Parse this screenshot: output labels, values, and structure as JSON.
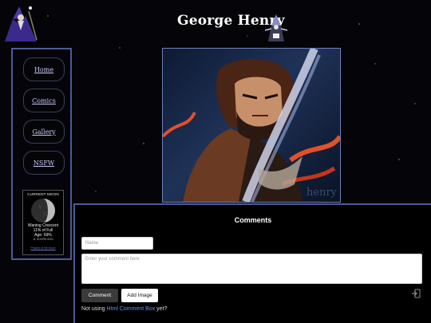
{
  "header": {
    "title": "George Henry"
  },
  "nav": {
    "items": [
      {
        "label": "Home"
      },
      {
        "label": "Comics"
      },
      {
        "label": "Gallery"
      },
      {
        "label": "NSFW"
      }
    ]
  },
  "moon": {
    "title": "CURRENT MOON",
    "phase": "Waning Crescent",
    "illumination": "11% of Full",
    "age": "Age: 69%",
    "extra": "11 HOURS AGO",
    "link": "Phases of the Moon"
  },
  "artwork": {
    "watermark": "henry"
  },
  "comments": {
    "heading": "Comments",
    "name_placeholder": "Name",
    "comment_placeholder": "Enter your comment here",
    "comment_button": "Comment",
    "add_image_button": "Add Image",
    "footer_prefix": "Not using",
    "footer_link": "Html Comment Box",
    "footer_suffix": "yet?"
  }
}
